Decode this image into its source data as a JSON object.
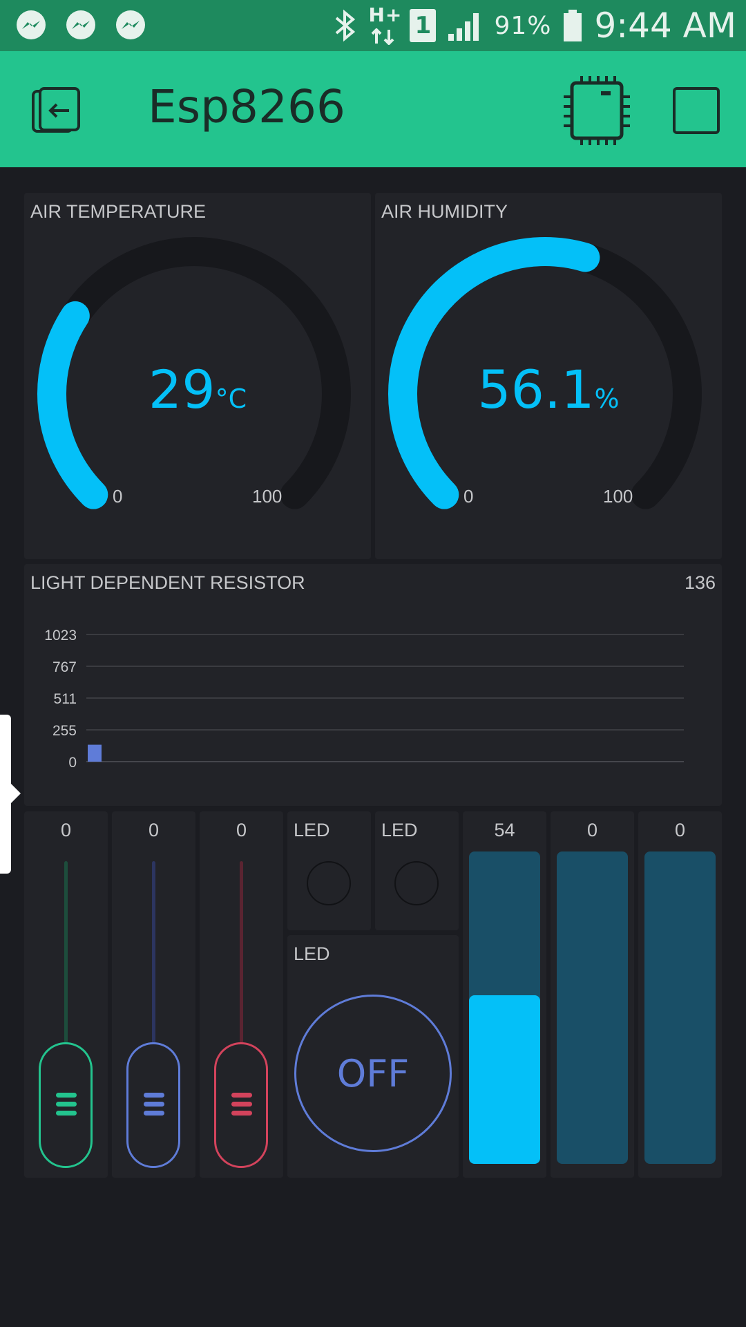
{
  "status_bar": {
    "notifications": [
      "messenger-icon",
      "messenger-icon",
      "messenger-icon"
    ],
    "network": "H+",
    "sim": "1",
    "battery": "91%",
    "time": "9:44 AM"
  },
  "app_bar": {
    "title": "Esp8266"
  },
  "gauges": [
    {
      "label": "AIR TEMPERATURE",
      "value": "29",
      "unit": "°C",
      "min": "0",
      "max": "100",
      "fraction": 0.29
    },
    {
      "label": "AIR HUMIDITY",
      "value": "56.1",
      "unit": "%",
      "min": "0",
      "max": "100",
      "fraction": 0.561
    }
  ],
  "graph": {
    "label": "LIGHT DEPENDENT RESISTOR",
    "current_value": "136",
    "chart_data": {
      "type": "bar",
      "y_ticks": [
        "1023",
        "767",
        "511",
        "255",
        "0"
      ],
      "ylim": [
        0,
        1023
      ],
      "values": [
        136
      ]
    }
  },
  "sliders": [
    {
      "value": "0",
      "color": "#23c48e"
    },
    {
      "value": "0",
      "color": "#5f7cd8"
    },
    {
      "value": "0",
      "color": "#d3435c"
    }
  ],
  "leds": [
    {
      "label": "LED"
    },
    {
      "label": "LED"
    }
  ],
  "button": {
    "label": "LED",
    "state": "OFF"
  },
  "level_displays": [
    {
      "value": "54",
      "fraction": 0.54
    },
    {
      "value": "0",
      "fraction": 0
    },
    {
      "value": "0",
      "fraction": 0
    }
  ],
  "colors": {
    "accent": "#04c0f8",
    "appbar": "#23c48e",
    "statusbar": "#1e8a5e",
    "background": "#1b1c21",
    "panel": "#222328",
    "button": "#5f7cd8"
  }
}
